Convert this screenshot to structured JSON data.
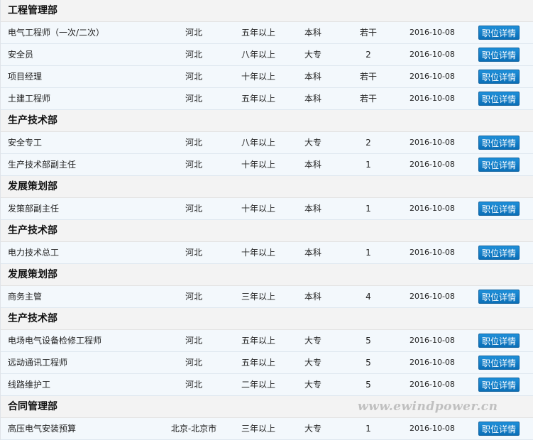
{
  "button_label": "职位详情",
  "colors": {
    "accent": "#0a6fb8",
    "row_bg": "#f3f8fc",
    "dept_bg": "#f3f3f3"
  },
  "watermark": "www.ewindpower.cn",
  "sections": [
    {
      "dept": "工程管理部",
      "jobs": [
        {
          "title": "电气工程师（一次/二次）",
          "location": "河北",
          "experience": "五年以上",
          "education": "本科",
          "count": "若干",
          "date": "2016-10-08"
        },
        {
          "title": "安全员",
          "location": "河北",
          "experience": "八年以上",
          "education": "大专",
          "count": "2",
          "date": "2016-10-08"
        },
        {
          "title": "项目经理",
          "location": "河北",
          "experience": "十年以上",
          "education": "本科",
          "count": "若干",
          "date": "2016-10-08"
        },
        {
          "title": "土建工程师",
          "location": "河北",
          "experience": "五年以上",
          "education": "本科",
          "count": "若干",
          "date": "2016-10-08"
        }
      ]
    },
    {
      "dept": "生产技术部",
      "jobs": [
        {
          "title": "安全专工",
          "location": "河北",
          "experience": "八年以上",
          "education": "大专",
          "count": "2",
          "date": "2016-10-08"
        },
        {
          "title": "生产技术部副主任",
          "location": "河北",
          "experience": "十年以上",
          "education": "本科",
          "count": "1",
          "date": "2016-10-08"
        }
      ]
    },
    {
      "dept": "发展策划部",
      "jobs": [
        {
          "title": "发策部副主任",
          "location": "河北",
          "experience": "十年以上",
          "education": "本科",
          "count": "1",
          "date": "2016-10-08"
        }
      ]
    },
    {
      "dept": "生产技术部",
      "jobs": [
        {
          "title": "电力技术总工",
          "location": "河北",
          "experience": "十年以上",
          "education": "本科",
          "count": "1",
          "date": "2016-10-08"
        }
      ]
    },
    {
      "dept": "发展策划部",
      "jobs": [
        {
          "title": "商务主管",
          "location": "河北",
          "experience": "三年以上",
          "education": "本科",
          "count": "4",
          "date": "2016-10-08"
        }
      ]
    },
    {
      "dept": "生产技术部",
      "jobs": [
        {
          "title": "电场电气设备检修工程师",
          "location": "河北",
          "experience": "五年以上",
          "education": "大专",
          "count": "5",
          "date": "2016-10-08"
        },
        {
          "title": "远动通讯工程师",
          "location": "河北",
          "experience": "五年以上",
          "education": "大专",
          "count": "5",
          "date": "2016-10-08"
        },
        {
          "title": "线路维护工",
          "location": "河北",
          "experience": "二年以上",
          "education": "大专",
          "count": "5",
          "date": "2016-10-08"
        }
      ]
    },
    {
      "dept": "合同管理部",
      "jobs": [
        {
          "title": "高压电气安装预算",
          "location": "北京-北京市",
          "experience": "三年以上",
          "education": "大专",
          "count": "1",
          "date": "2016-10-08"
        }
      ]
    }
  ]
}
